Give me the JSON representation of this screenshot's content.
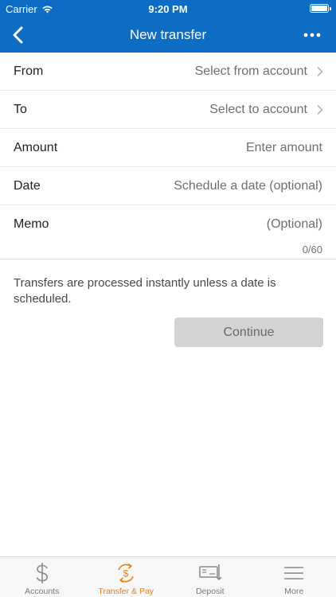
{
  "status_bar": {
    "carrier": "Carrier",
    "time": "9:20 PM"
  },
  "nav": {
    "title": "New transfer",
    "back_icon": "chevron-left-icon",
    "more_icon": "ellipsis-icon"
  },
  "form": {
    "from": {
      "label": "From",
      "value": "Select from account"
    },
    "to": {
      "label": "To",
      "value": "Select to account"
    },
    "amount": {
      "label": "Amount",
      "placeholder": "Enter amount"
    },
    "date": {
      "label": "Date",
      "placeholder": "Schedule a date (optional)"
    },
    "memo": {
      "label": "Memo",
      "placeholder": "(Optional)",
      "counter": "0/60"
    }
  },
  "info_text": "Transfers are processed instantly unless a date is scheduled.",
  "continue_label": "Continue",
  "tabs": [
    {
      "label": "Accounts",
      "icon": "dollar-icon",
      "active": false
    },
    {
      "label": "Transfer & Pay",
      "icon": "transfer-pay-icon",
      "active": true
    },
    {
      "label": "Deposit",
      "icon": "deposit-check-icon",
      "active": false
    },
    {
      "label": "More",
      "icon": "menu-icon",
      "active": false
    }
  ],
  "colors": {
    "header": "#0d6cc4",
    "accent": "#ee7f19",
    "button_disabled": "#d3d3d3"
  }
}
